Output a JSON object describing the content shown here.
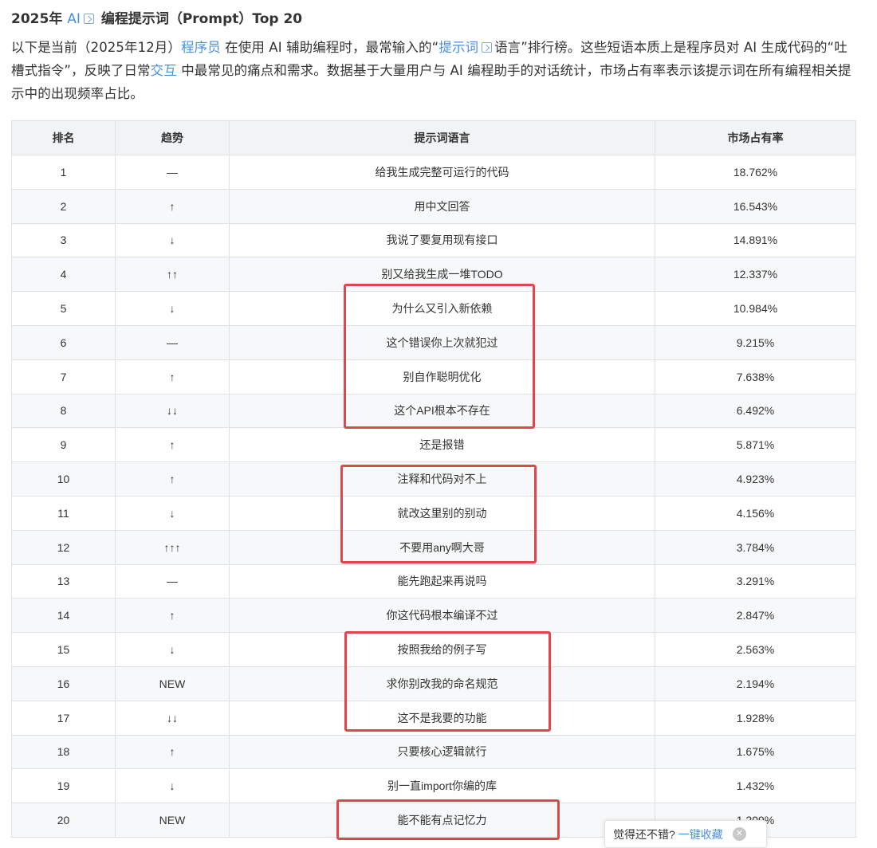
{
  "title": {
    "prefix": "2025年",
    "ai_link": "AI",
    "suffix": "编程提示词（Prompt）Top 20"
  },
  "intro": {
    "part1": "以下是当前（2025年12月）",
    "link_programmer": "程序员",
    "part2": " 在使用 AI 辅助编程时，最常输入的“",
    "link_prompt": "提示词",
    "part3": "语言”排行榜。这些短语本质上是程序员对 AI 生成代码的“吐槽式指令”，反映了日常",
    "link_interaction": "交互",
    "part4": " 中最常见的痛点和需求。数据基于大量用户与 AI 编程助手的对话统计，市场占有率表示该提示词在所有编程相关提示中的出现频率占比。"
  },
  "table": {
    "headers": [
      "排名",
      "趋势",
      "提示词语言",
      "市场占有率"
    ],
    "rows": [
      {
        "rank": "1",
        "trend": "—",
        "prompt": "给我生成完整可运行的代码",
        "share": "18.762%"
      },
      {
        "rank": "2",
        "trend": "↑",
        "prompt": "用中文回答",
        "share": "16.543%"
      },
      {
        "rank": "3",
        "trend": "↓",
        "prompt": "我说了要复用现有接口",
        "share": "14.891%"
      },
      {
        "rank": "4",
        "trend": "↑↑",
        "prompt": "别又给我生成一堆TODO",
        "share": "12.337%"
      },
      {
        "rank": "5",
        "trend": "↓",
        "prompt": "为什么又引入新依赖",
        "share": "10.984%"
      },
      {
        "rank": "6",
        "trend": "—",
        "prompt": "这个错误你上次就犯过",
        "share": "9.215%"
      },
      {
        "rank": "7",
        "trend": "↑",
        "prompt": "别自作聪明优化",
        "share": "7.638%"
      },
      {
        "rank": "8",
        "trend": "↓↓",
        "prompt": "这个API根本不存在",
        "share": "6.492%"
      },
      {
        "rank": "9",
        "trend": "↑",
        "prompt": "还是报错",
        "share": "5.871%"
      },
      {
        "rank": "10",
        "trend": "↑",
        "prompt": "注释和代码对不上",
        "share": "4.923%"
      },
      {
        "rank": "11",
        "trend": "↓",
        "prompt": "就改这里别的别动",
        "share": "4.156%"
      },
      {
        "rank": "12",
        "trend": "↑↑↑",
        "prompt": "不要用any啊大哥",
        "share": "3.784%"
      },
      {
        "rank": "13",
        "trend": "—",
        "prompt": "能先跑起来再说吗",
        "share": "3.291%"
      },
      {
        "rank": "14",
        "trend": "↑",
        "prompt": "你这代码根本编译不过",
        "share": "2.847%"
      },
      {
        "rank": "15",
        "trend": "↓",
        "prompt": "按照我给的例子写",
        "share": "2.563%"
      },
      {
        "rank": "16",
        "trend": "NEW",
        "prompt": "求你别改我的命名规范",
        "share": "2.194%"
      },
      {
        "rank": "17",
        "trend": "↓↓",
        "prompt": "这不是我要的功能",
        "share": "1.928%"
      },
      {
        "rank": "18",
        "trend": "↑",
        "prompt": "只要核心逻辑就行",
        "share": "1.675%"
      },
      {
        "rank": "19",
        "trend": "↓",
        "prompt": "别一直import你编的库",
        "share": "1.432%"
      },
      {
        "rank": "20",
        "trend": "NEW",
        "prompt": "能不能有点记忆力",
        "share": "1.209%"
      }
    ]
  },
  "toast": {
    "text": "觉得还不错?",
    "action": "一键收藏",
    "close_glyph": "✕"
  },
  "colors": {
    "link": "#4a90e2",
    "highlight_box": "#e0474d",
    "header_bg": "#f1f3f4",
    "border": "#dfe2e5"
  }
}
